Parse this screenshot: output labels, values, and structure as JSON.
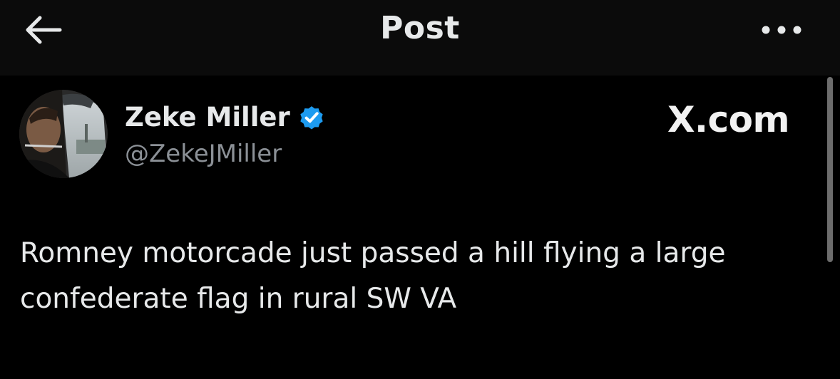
{
  "header": {
    "title": "Post",
    "back_icon": "arrow-left-icon",
    "more_icon": "more-horizontal-icon"
  },
  "post": {
    "author": {
      "name": "Zeke Miller",
      "handle": "@ZekeJMiller",
      "verified": true,
      "verified_color": "#1d9bf0"
    },
    "watermark": "X.com",
    "text": "Romney motorcade just passed a hill flying a large\nconfederate flag in rural SW VA"
  },
  "colors": {
    "background": "#000000",
    "header_background": "#0b0b0b",
    "primary_text": "#e7e9ea",
    "secondary_text": "#8b9096",
    "verified_blue": "#1d9bf0"
  }
}
